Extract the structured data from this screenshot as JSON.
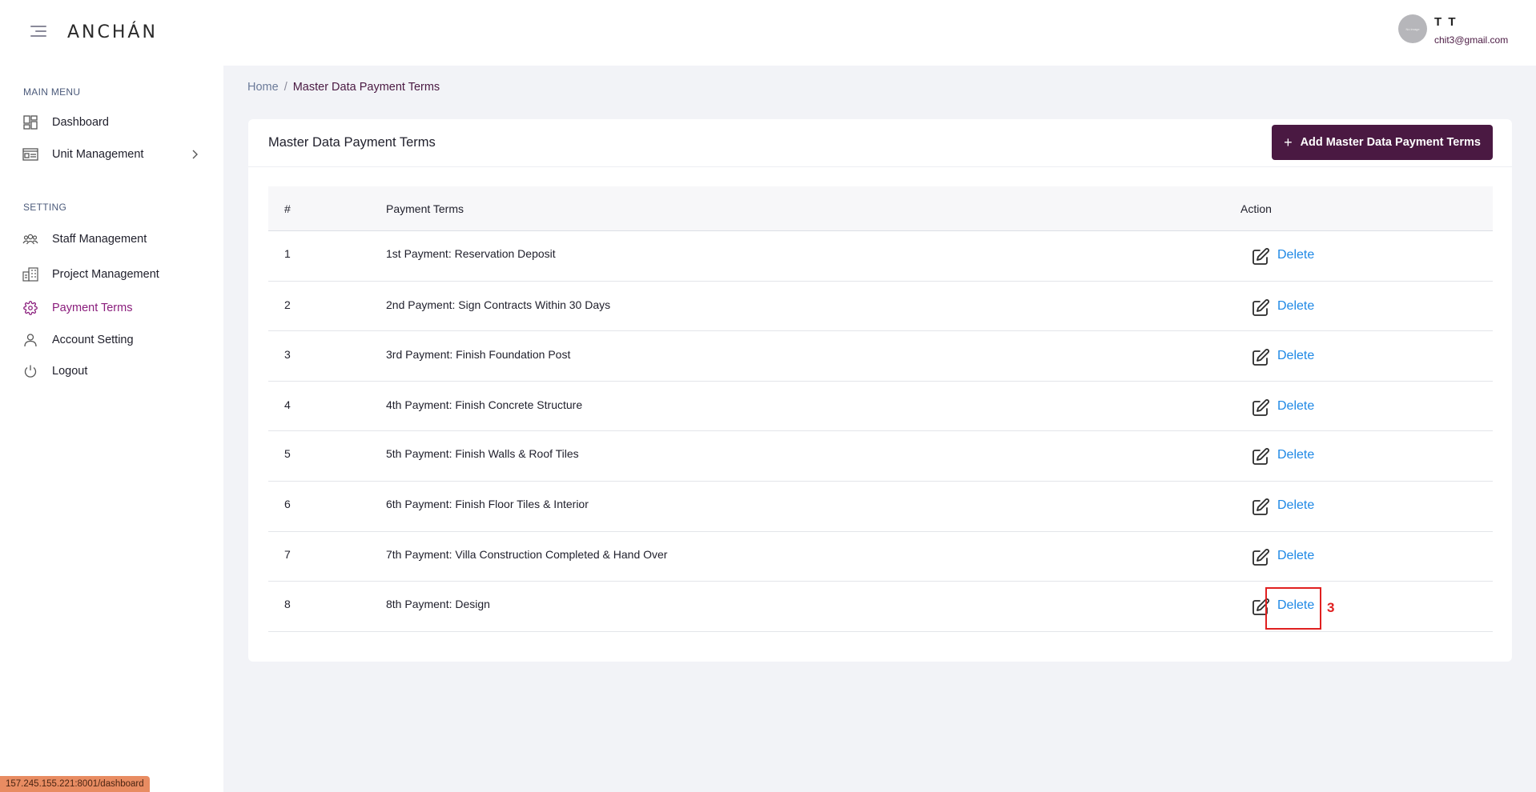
{
  "header": {
    "logo": "ANCHÁN",
    "user_name": "T T",
    "user_email": "chit3@gmail.com",
    "avatar_text": "No image"
  },
  "sidebar": {
    "main_menu_heading": "MAIN MENU",
    "setting_heading": "SETTING",
    "items": [
      {
        "label": "Dashboard",
        "icon": "dashboard-icon"
      },
      {
        "label": "Unit Management",
        "icon": "unit-management-icon"
      },
      {
        "label": "Staff Management",
        "icon": "staff-icon"
      },
      {
        "label": "Project Management",
        "icon": "project-icon"
      },
      {
        "label": "Payment Terms",
        "icon": "gear-icon",
        "active": true
      },
      {
        "label": "Account Setting",
        "icon": "user-icon"
      },
      {
        "label": "Logout",
        "icon": "power-icon"
      }
    ]
  },
  "breadcrumb": {
    "home": "Home",
    "separator": "/",
    "current": "Master Data Payment Terms"
  },
  "card": {
    "title": "Master Data Payment Terms",
    "add_button_label": "Add Master Data Payment Terms"
  },
  "table": {
    "headers": [
      "#",
      "Payment Terms",
      "Action"
    ],
    "rows": [
      {
        "num": "1",
        "term": "1st  Payment:  Reservation Deposit",
        "action": "Delete"
      },
      {
        "num": "2",
        "term": "2nd Payment: Sign Contracts Within 30 Days",
        "action": "Delete"
      },
      {
        "num": "3",
        "term": "3rd Payment: Finish Foundation Post",
        "action": "Delete"
      },
      {
        "num": "4",
        "term": "4th Payment: Finish Concrete Structure",
        "action": "Delete"
      },
      {
        "num": "5",
        "term": "5th Payment: Finish Walls & Roof Tiles",
        "action": "Delete"
      },
      {
        "num": "6",
        "term": "6th Payment: Finish Floor Tiles & Interior",
        "action": "Delete"
      },
      {
        "num": "7",
        "term": "7th Payment: Villa Construction Completed & Hand Over",
        "action": "Delete"
      },
      {
        "num": "8",
        "term": "8th Payment: Design",
        "action": "Delete"
      }
    ]
  },
  "annotation": {
    "label": "3"
  },
  "status_bar": {
    "url": "157.245.155.221:8001/dashboard"
  },
  "colors": {
    "brand": "#4a1942",
    "active": "#8a1d7c",
    "link": "#1e88e5",
    "highlight": "#e02020"
  }
}
